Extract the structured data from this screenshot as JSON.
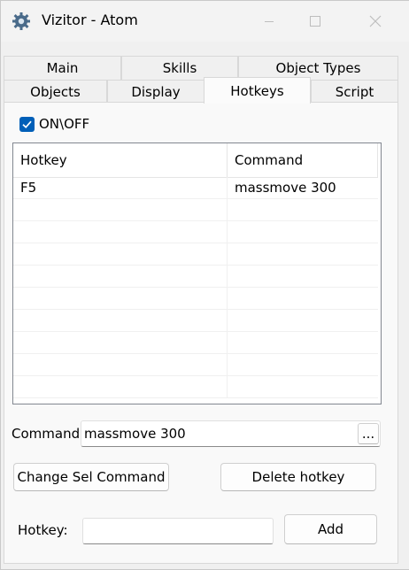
{
  "window": {
    "title": "Vizitor - Atom"
  },
  "tabs_row1": [
    "Main",
    "Skills",
    "Object Types"
  ],
  "tabs_row2": [
    "Objects",
    "Display",
    "Hotkeys",
    "Script"
  ],
  "active_tab": "Hotkeys",
  "toggle": {
    "label": "ON\\OFF",
    "checked": true
  },
  "table": {
    "columns": [
      "Hotkey",
      "Command"
    ],
    "rows": [
      {
        "hotkey": "F5",
        "command": "massmove 300"
      }
    ]
  },
  "command": {
    "label": "Command:",
    "value": "massmove 300",
    "browse_label": "..."
  },
  "buttons": {
    "change": "Change Sel Command",
    "delete": "Delete hotkey",
    "add": "Add"
  },
  "hotkey": {
    "label": "Hotkey:",
    "value": ""
  },
  "colors": {
    "accent": "#005fb8"
  }
}
